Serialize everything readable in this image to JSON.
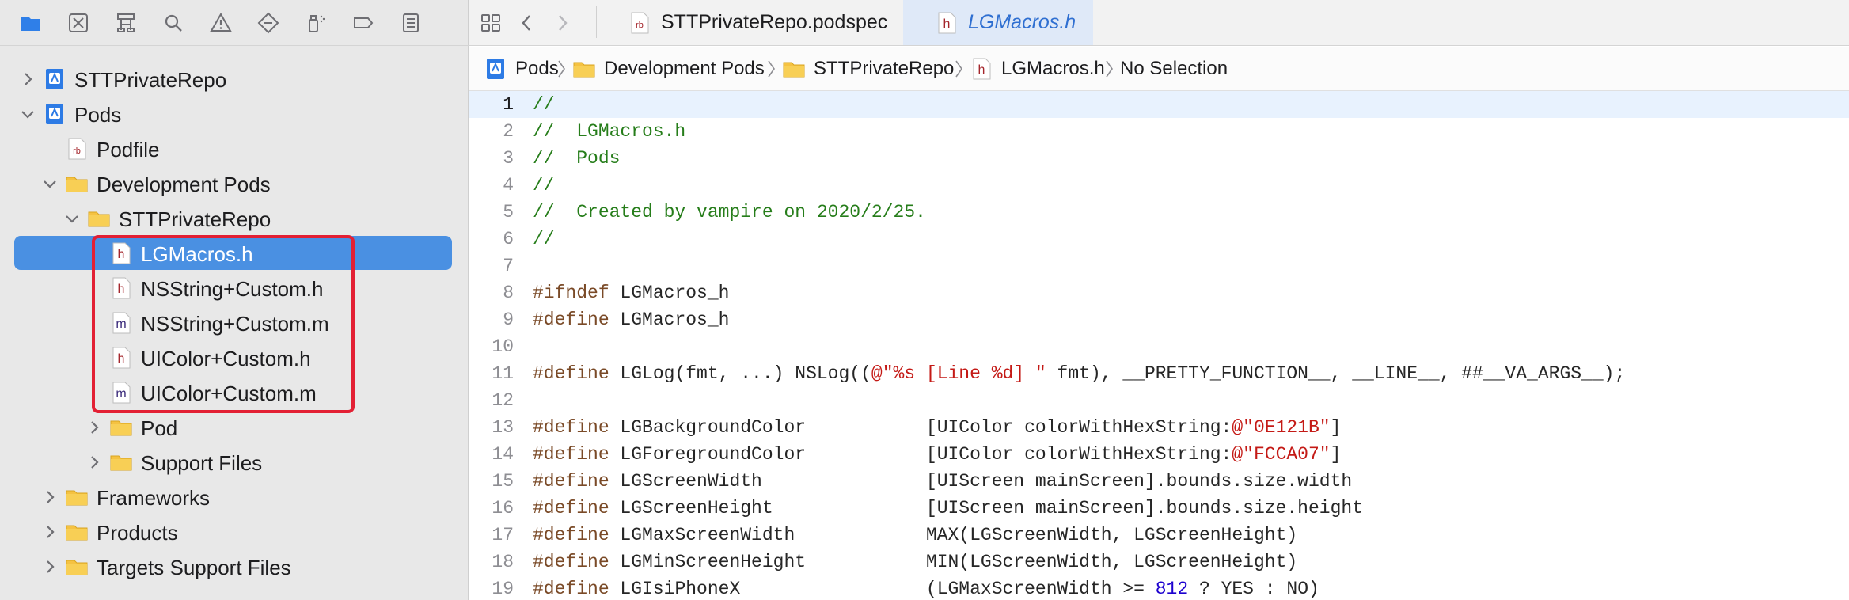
{
  "navigator": {
    "toolbar_icons": [
      "folder-icon",
      "source-control-icon",
      "symbol-hierarchy-icon",
      "find-icon",
      "issue-warning-icon",
      "test-diamond-icon",
      "debug-spray-icon",
      "breakpoint-icon",
      "report-icon"
    ],
    "tree": [
      {
        "label": "STTPrivateRepo",
        "icon": "project-icon",
        "expanded": false,
        "level": 0
      },
      {
        "label": "Pods",
        "icon": "project-icon",
        "expanded": true,
        "level": 0
      },
      {
        "label": "Podfile",
        "icon": "rb-file-icon",
        "level": 1
      },
      {
        "label": "Development Pods",
        "icon": "folder-icon",
        "expanded": true,
        "level": 1
      },
      {
        "label": "STTPrivateRepo",
        "icon": "folder-icon",
        "expanded": true,
        "level": 2
      },
      {
        "label": "LGMacros.h",
        "icon": "h-file-icon",
        "level": 3,
        "selected": true
      },
      {
        "label": "NSString+Custom.h",
        "icon": "h-file-icon",
        "level": 3
      },
      {
        "label": "NSString+Custom.m",
        "icon": "m-file-icon",
        "level": 3
      },
      {
        "label": "UIColor+Custom.h",
        "icon": "h-file-icon",
        "level": 3
      },
      {
        "label": "UIColor+Custom.m",
        "icon": "m-file-icon",
        "level": 3
      },
      {
        "label": "Pod",
        "icon": "folder-icon",
        "expanded": false,
        "level": 3
      },
      {
        "label": "Support Files",
        "icon": "folder-icon",
        "expanded": false,
        "level": 3
      },
      {
        "label": "Frameworks",
        "icon": "folder-icon",
        "expanded": false,
        "level": 1
      },
      {
        "label": "Products",
        "icon": "folder-icon",
        "expanded": false,
        "level": 1
      },
      {
        "label": "Targets Support Files",
        "icon": "folder-icon",
        "expanded": false,
        "level": 1
      }
    ]
  },
  "editor": {
    "tabs": [
      {
        "label": "STTPrivateRepo.podspec",
        "icon": "rb-file-icon",
        "active": false
      },
      {
        "label": "LGMacros.h",
        "icon": "h-file-icon",
        "active": true
      }
    ],
    "breadcrumb": [
      {
        "label": "Pods",
        "icon": "project-icon"
      },
      {
        "label": "Development Pods",
        "icon": "folder-icon"
      },
      {
        "label": "STTPrivateRepo",
        "icon": "folder-icon"
      },
      {
        "label": "LGMacros.h",
        "icon": "h-file-icon"
      },
      {
        "label": "No Selection",
        "icon": ""
      }
    ],
    "current_line": 1,
    "lines": [
      {
        "n": "1",
        "text": "//"
      },
      {
        "n": "2",
        "text": "//  LGMacros.h"
      },
      {
        "n": "3",
        "text": "//  Pods"
      },
      {
        "n": "4",
        "text": "//"
      },
      {
        "n": "5",
        "text": "//  Created by vampire on 2020/2/25."
      },
      {
        "n": "6",
        "text": "//"
      },
      {
        "n": "7",
        "text": ""
      },
      {
        "n": "8",
        "text": "#ifndef LGMacros_h"
      },
      {
        "n": "9",
        "text": "#define LGMacros_h"
      },
      {
        "n": "10",
        "text": ""
      },
      {
        "n": "11",
        "text": "#define LGLog(fmt, ...) NSLog((@\"%s [Line %d] \" fmt), __PRETTY_FUNCTION__, __LINE__, ##__VA_ARGS__);"
      },
      {
        "n": "12",
        "text": ""
      },
      {
        "n": "13",
        "text": "#define LGBackgroundColor           [UIColor colorWithHexString:@\"0E121B\"]"
      },
      {
        "n": "14",
        "text": "#define LGForegroundColor           [UIColor colorWithHexString:@\"FCCA07\"]"
      },
      {
        "n": "15",
        "text": "#define LGScreenWidth               [UIScreen mainScreen].bounds.size.width"
      },
      {
        "n": "16",
        "text": "#define LGScreenHeight              [UIScreen mainScreen].bounds.size.height"
      },
      {
        "n": "17",
        "text": "#define LGMaxScreenWidth            MAX(LGScreenWidth, LGScreenHeight)"
      },
      {
        "n": "18",
        "text": "#define LGMinScreenHeight           MIN(LGScreenWidth, LGScreenHeight)"
      },
      {
        "n": "19",
        "text": "#define LGIsiPhoneX                 (LGMaxScreenWidth >= 812 ? YES : NO)"
      }
    ]
  },
  "colors": {
    "selection": "#4a90e2",
    "highlight_box": "#e32034",
    "comment": "#267d1a",
    "preprocessor": "#7a4a27",
    "string": "#c41a16",
    "number": "#1c00cf",
    "folder": "#f5c242",
    "accent": "#2f6fd1"
  }
}
